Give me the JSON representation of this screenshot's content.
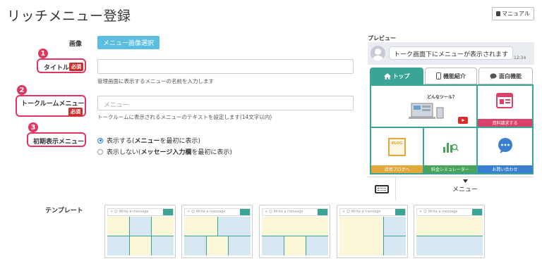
{
  "page": {
    "title": "リッチメニュー登録"
  },
  "manual_button": {
    "label": "マニュアル",
    "icon": "book-icon"
  },
  "form": {
    "image": {
      "label": "画像",
      "button": "メニュー画像選択"
    },
    "title": {
      "number": "1",
      "label": "タイトル",
      "required": "必須",
      "value": "",
      "hint": "管理画面に表示するメニューの名前を入力します"
    },
    "talkroom": {
      "number": "2",
      "label": "トークルームメニュー",
      "required": "必須",
      "placeholder": "メニュー",
      "hint": "トークルームに表示されるメニューのテキストを設定します(14文字以内)"
    },
    "default_display": {
      "number": "3",
      "label": "初期表示メニュー",
      "options": [
        {
          "text": "表示する(",
          "bold": "メニュー",
          "rest": "を最初に表示)",
          "selected": true
        },
        {
          "text": "表示しない(",
          "bold": "メッセージ入力欄",
          "rest": "を最初に表示)",
          "selected": false
        }
      ]
    }
  },
  "preview": {
    "label": "プレビュー",
    "chat_bubble": "トーク画面下にメニューが表示されます",
    "chat_time": "12:34",
    "tabs": [
      {
        "label": "トップ",
        "icon": "home-icon"
      },
      {
        "label": "機能紹介",
        "icon": "smartphone-icon"
      },
      {
        "label": "面白機能",
        "icon": "speech-bubble-icon"
      }
    ],
    "cells": {
      "hero": "どんなツール？",
      "document": "資料請求する",
      "blog": "活用ブログへ",
      "blog_icon_text": "BLOG",
      "simulator": "料金シミュレーター",
      "contact": "お問い合わせ"
    },
    "menu_toggle": "メニュー"
  },
  "templates": {
    "label": "テンプレート",
    "input_placeholder": "Write a message",
    "count": 5
  },
  "colors": {
    "accent": "#e0355f",
    "teal": "#3aa596",
    "button_blue": "#5bbde0"
  }
}
